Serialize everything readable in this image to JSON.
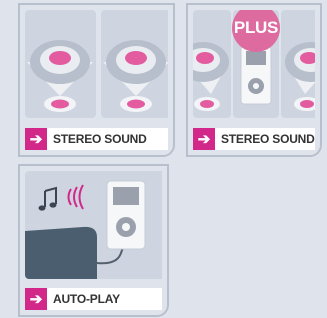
{
  "colors": {
    "accent": "#d2288a",
    "plus_badge": "#de6b9f",
    "background": "#dfe3ec",
    "card_border": "#b9c0cd"
  },
  "cards": [
    {
      "caption": "STEREO SOUND",
      "arrow_icon": "arrow-right-icon"
    },
    {
      "caption": "STEREO SOUND",
      "badge": "PLUS",
      "arrow_icon": "arrow-right-icon"
    },
    {
      "caption": "AUTO-PLAY",
      "arrow_icon": "arrow-right-icon"
    }
  ]
}
